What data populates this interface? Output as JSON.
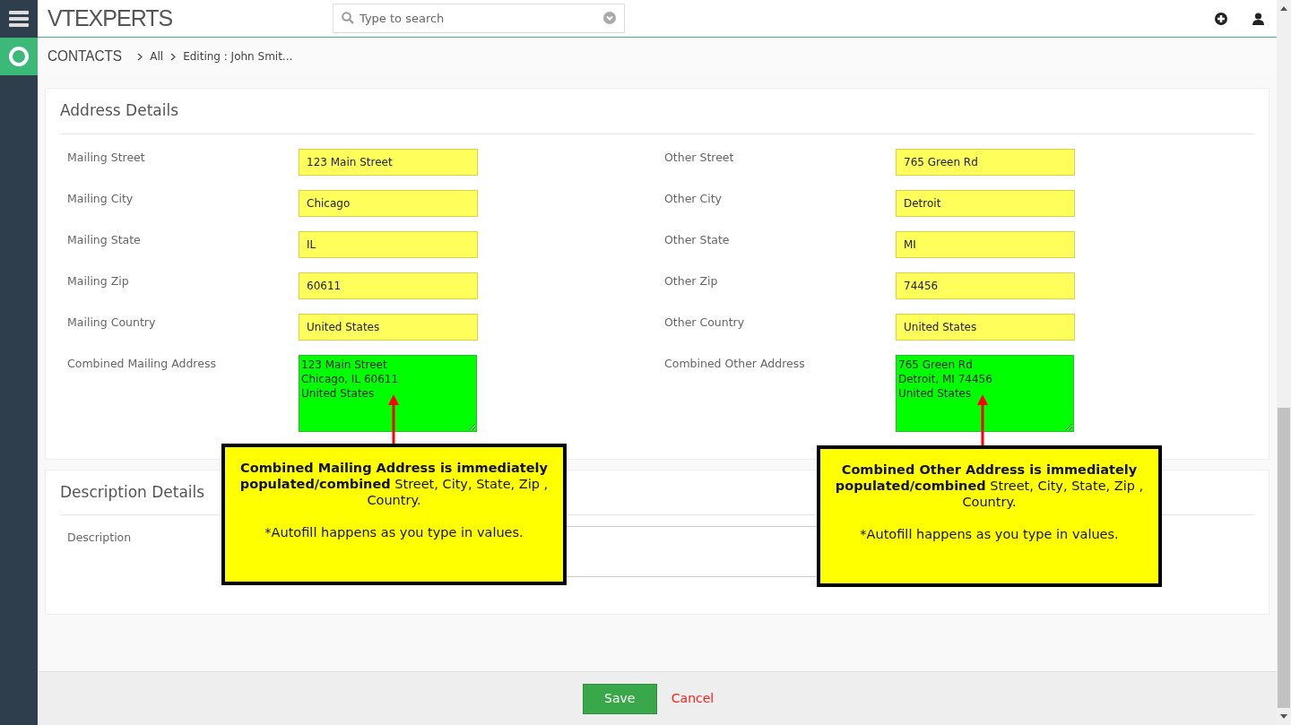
{
  "header": {
    "logo": "VTEXPERTS",
    "search": {
      "placeholder": "Type to search"
    }
  },
  "breadcrumb": {
    "module": "CONTACTS",
    "items": [
      "All",
      "Editing : John Smit..."
    ]
  },
  "address": {
    "title": "Address Details",
    "left": [
      {
        "label": "Mailing Street",
        "value": "123 Main Street",
        "kind": "input"
      },
      {
        "label": "Mailing City",
        "value": "Chicago",
        "kind": "input"
      },
      {
        "label": "Mailing State",
        "value": "IL",
        "kind": "input"
      },
      {
        "label": "Mailing Zip",
        "value": "60611",
        "kind": "input"
      },
      {
        "label": "Mailing Country",
        "value": "United States",
        "kind": "input"
      },
      {
        "label": "Combined Mailing Address",
        "value": "123 Main Street\nChicago, IL 60611\nUnited States",
        "kind": "textarea"
      }
    ],
    "right": [
      {
        "label": "Other Street",
        "value": "765 Green Rd",
        "kind": "input"
      },
      {
        "label": "Other City",
        "value": "Detroit",
        "kind": "input"
      },
      {
        "label": "Other State",
        "value": "MI",
        "kind": "input"
      },
      {
        "label": "Other Zip",
        "value": "74456",
        "kind": "input"
      },
      {
        "label": "Other Country",
        "value": "United States",
        "kind": "input"
      },
      {
        "label": "Combined Other Address",
        "value": "765 Green Rd\nDetroit, MI 74456\nUnited States",
        "kind": "textarea"
      }
    ]
  },
  "description": {
    "title": "Description Details",
    "label": "Description"
  },
  "callouts": [
    {
      "text": "**Combined Mailing Address is immediately populated/combined** Street, City, State, Zip , Country.",
      "note": "*Autofill happens as you type in values."
    },
    {
      "text": "**Combined Other Address is immediately populated/combined** Street, City, State, Zip , Country.",
      "note": "*Autofill happens as you type in values."
    }
  ],
  "footer": {
    "save": "Save",
    "cancel": "Cancel"
  }
}
